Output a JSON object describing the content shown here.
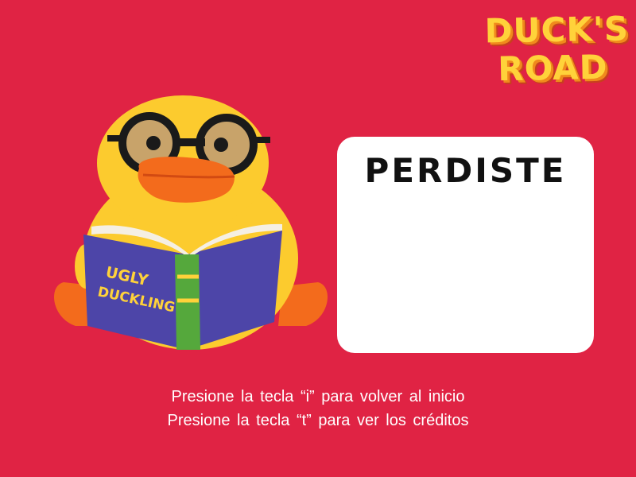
{
  "logo": {
    "line1": "DUCK'S",
    "line2": "ROAD"
  },
  "book": {
    "title_line1": "UGLY",
    "title_line2": "DUCKLING"
  },
  "result": {
    "title": "PERDISTE"
  },
  "instructions": {
    "line1": "Presione la tecla “i” para volver al inicio",
    "line2": "Presione la tecla “t” para ver los créditos"
  },
  "colors": {
    "background": "#e02344",
    "logo": "#ffd23a",
    "duck": "#fccb2e",
    "beak": "#f36b1c",
    "book_cover": "#4d45a8",
    "book_spine": "#55a83c",
    "panel": "#ffffff"
  },
  "icons": [
    "duck-illustration",
    "glasses-icon",
    "book-icon"
  ]
}
